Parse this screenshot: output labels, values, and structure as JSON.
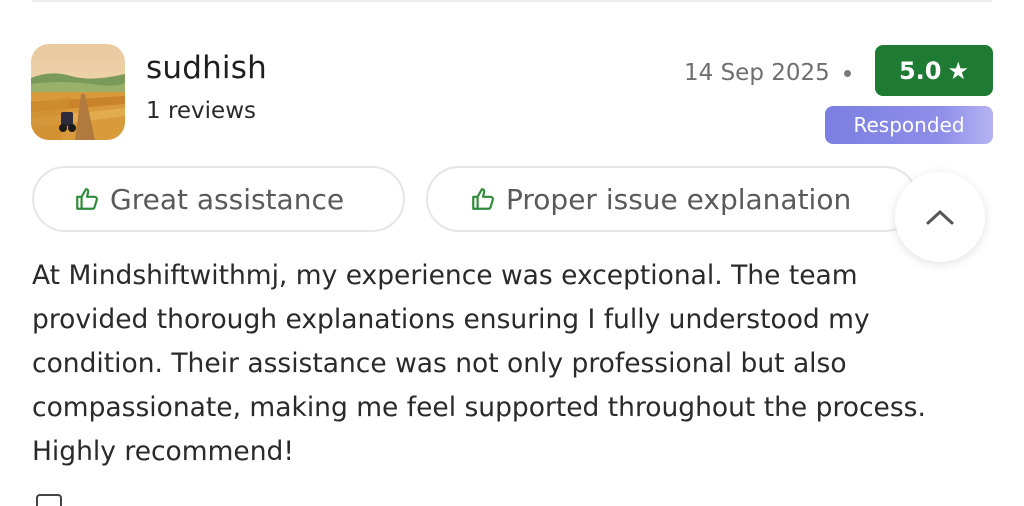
{
  "reviewer": {
    "name": "sudhish",
    "review_count": "1 reviews",
    "avatar_icon": "farm-landscape-avatar"
  },
  "meta": {
    "date": "14 Sep 2025",
    "rating": "5.0",
    "rating_icon": "star-icon",
    "status": "Responded"
  },
  "tags": [
    {
      "label": "Great assistance",
      "icon": "thumbs-up-icon"
    },
    {
      "label": "Proper issue explanation",
      "icon": "thumbs-up-icon"
    }
  ],
  "collapse_icon": "chevron-up-icon",
  "review": {
    "text": "At Mindshiftwithmj, my experience was exceptional. The team provided thorough explanations ensuring I fully understood my condition. Their assistance was not only professional but also compassionate, making me feel supported throughout the process. Highly recommend!"
  },
  "colors": {
    "rating_badge": "#1f7a33",
    "responded_badge": "#8f8fea",
    "thumb_icon": "#2e8b3a"
  }
}
